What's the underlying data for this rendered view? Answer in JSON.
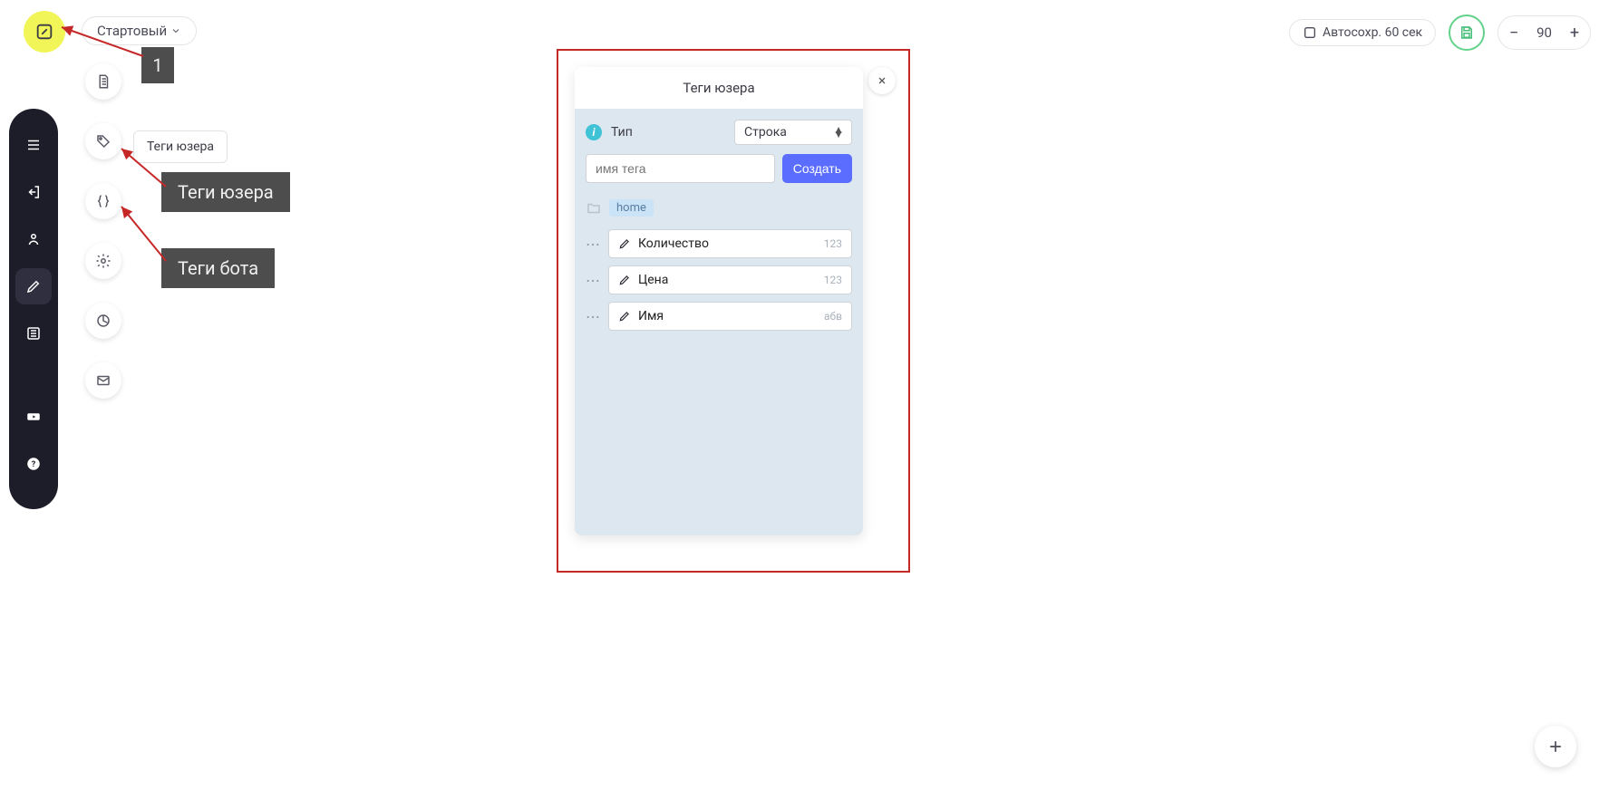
{
  "header": {
    "scenario_dropdown_label": "Стартовый",
    "autosave_label": "Автосохр. 60 сек",
    "zoom_value": "90"
  },
  "tooltip": {
    "user_tags": "Теги юзера"
  },
  "annotations": {
    "step1": "1",
    "user_tags": "Теги юзера",
    "bot_tags": "Теги  бота"
  },
  "panel": {
    "title": "Теги юзера",
    "type_label": "Тип",
    "type_value": "Строка",
    "input_placeholder": "имя тега",
    "create_button": "Создать",
    "folder": "home",
    "tags": [
      {
        "name": "Количество",
        "type": "123"
      },
      {
        "name": "Цена",
        "type": "123"
      },
      {
        "name": "Имя",
        "type": "абв"
      }
    ]
  }
}
